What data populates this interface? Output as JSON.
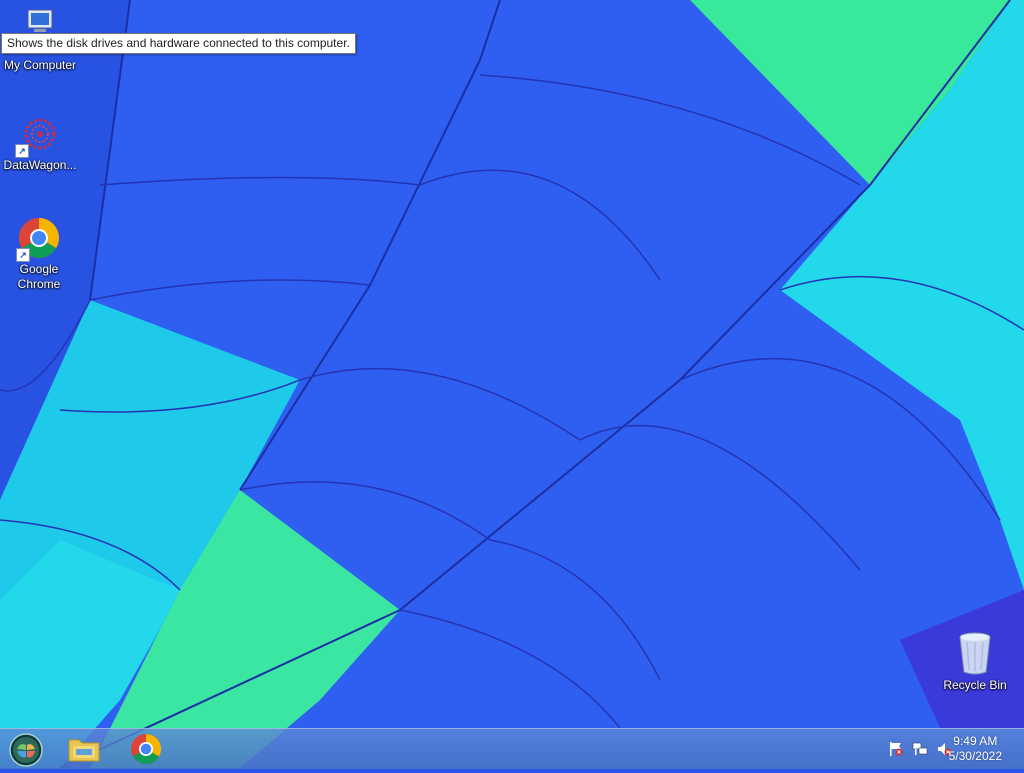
{
  "desktop": {
    "icons": [
      {
        "label": "My Computer"
      },
      {
        "label": "DataWagon..."
      },
      {
        "label": "Google Chrome"
      },
      {
        "label": "Recycle Bin"
      }
    ],
    "tooltip": "Shows the disk drives and hardware connected to this computer."
  },
  "taskbar": {
    "pinned": [
      {
        "icon": "start-orb-icon"
      },
      {
        "icon": "file-explorer-icon"
      },
      {
        "icon": "chrome-icon"
      }
    ],
    "tray": {
      "icons": [
        "action-center-flag-icon",
        "network-icon",
        "volume-muted-icon"
      ],
      "time": "9:49 AM",
      "date": "5/30/2022"
    }
  },
  "colors": {
    "wallpaper_blue": "#2a55e6",
    "wallpaper_cyan": "#19d6e8",
    "wallpaper_green": "#36e69a",
    "taskbar": "#4f7bd0"
  }
}
